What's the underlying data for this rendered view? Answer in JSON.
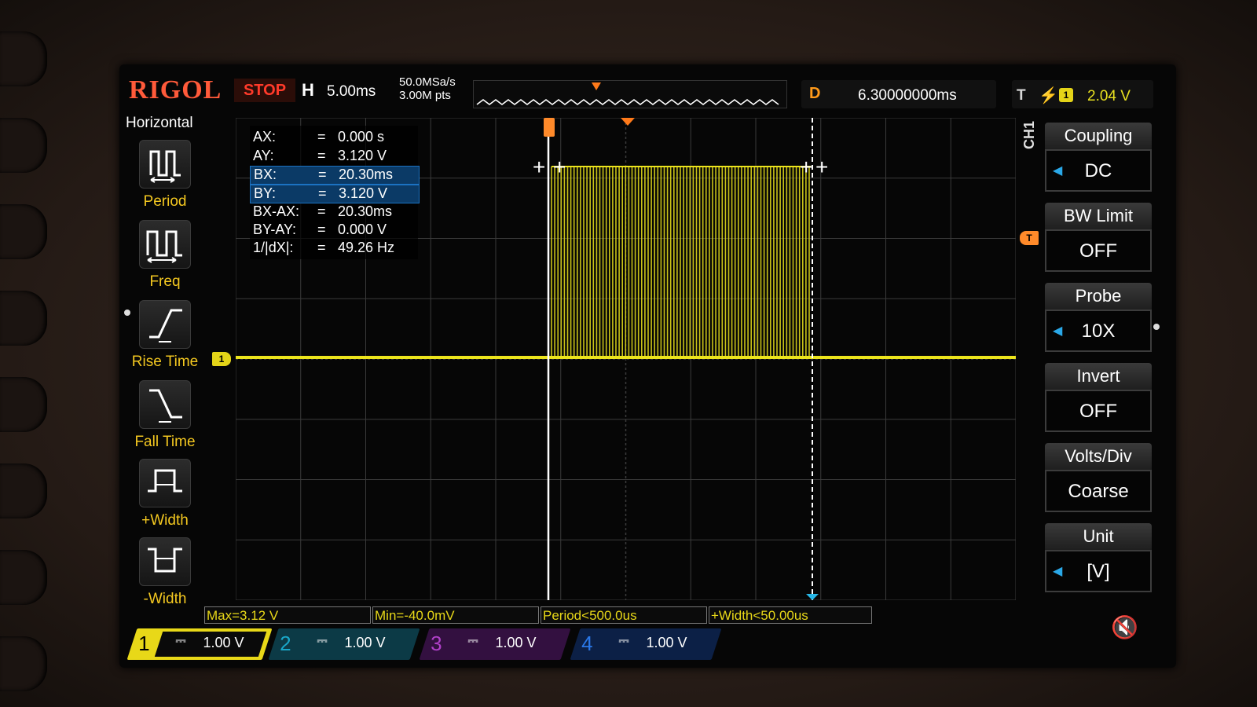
{
  "brand": "RIGOL",
  "run_status": "STOP",
  "timebase": {
    "letter": "H",
    "value": "5.00ms"
  },
  "acquisition": {
    "sample_rate": "50.0MSa/s",
    "memory_depth": "3.00M pts"
  },
  "delay": {
    "letter": "D",
    "value": "6.30000000ms"
  },
  "trigger": {
    "letter": "T",
    "edge_symbol": "⚡",
    "source": "1",
    "level": "2.04 V"
  },
  "left_menu": {
    "title": "Horizontal",
    "items": [
      {
        "label": "Period",
        "icon": "period-icon"
      },
      {
        "label": "Freq",
        "icon": "frequency-icon"
      },
      {
        "label": "Rise Time",
        "icon": "rise-time-icon"
      },
      {
        "label": "Fall Time",
        "icon": "fall-time-icon"
      },
      {
        "label": "+Width",
        "icon": "positive-width-icon"
      },
      {
        "label": "-Width",
        "icon": "negative-width-icon"
      }
    ]
  },
  "cursor_readout": [
    {
      "key": "AX:",
      "eq": "=",
      "value": "0.000 s",
      "selected": false
    },
    {
      "key": "AY:",
      "eq": "=",
      "value": "3.120 V",
      "selected": false
    },
    {
      "key": "BX:",
      "eq": "=",
      "value": "20.30ms",
      "selected": true
    },
    {
      "key": "BY:",
      "eq": "=",
      "value": "3.120 V",
      "selected": true
    },
    {
      "key": "BX-AX:",
      "eq": "=",
      "value": "20.30ms",
      "selected": false
    },
    {
      "key": "BY-AY:",
      "eq": "=",
      "value": "0.000 V",
      "selected": false
    },
    {
      "key": "1/|dX|:",
      "eq": "=",
      "value": "49.26 Hz",
      "selected": false
    }
  ],
  "measurements": [
    "Max=3.12 V",
    "Min=-40.0mV",
    "Period<500.0us",
    "+Width<50.00us"
  ],
  "channels": [
    {
      "num": "1",
      "coupling": "⎓",
      "scale": "1.00 V",
      "color": "#e8d818",
      "active": true
    },
    {
      "num": "2",
      "coupling": "⎓",
      "scale": "1.00 V",
      "color": "#19a6c8",
      "active": false
    },
    {
      "num": "3",
      "coupling": "⎓",
      "scale": "1.00 V",
      "color": "#b040c8",
      "active": false
    },
    {
      "num": "4",
      "coupling": "⎓",
      "scale": "1.00 V",
      "color": "#2068d8",
      "active": false
    }
  ],
  "channel_tag": "CH1",
  "right_menu": [
    {
      "title": "Coupling",
      "value": "DC",
      "arrow": true
    },
    {
      "title": "BW Limit",
      "value": "OFF",
      "arrow": false
    },
    {
      "title": "Probe",
      "value": "10X",
      "arrow": true
    },
    {
      "title": "Invert",
      "value": "OFF",
      "arrow": false
    },
    {
      "title": "Volts/Div",
      "value": "Coarse",
      "arrow": false
    },
    {
      "title": "Unit",
      "value": "[V]",
      "arrow": true
    }
  ],
  "markers": {
    "channel_ground": "1",
    "trigger_level": "T",
    "trigger_position": "T"
  },
  "colors": {
    "trace": "#ece41c",
    "grid": "#3a3a3a",
    "cursor": "#ffffff",
    "selected": "#0b3a66"
  }
}
